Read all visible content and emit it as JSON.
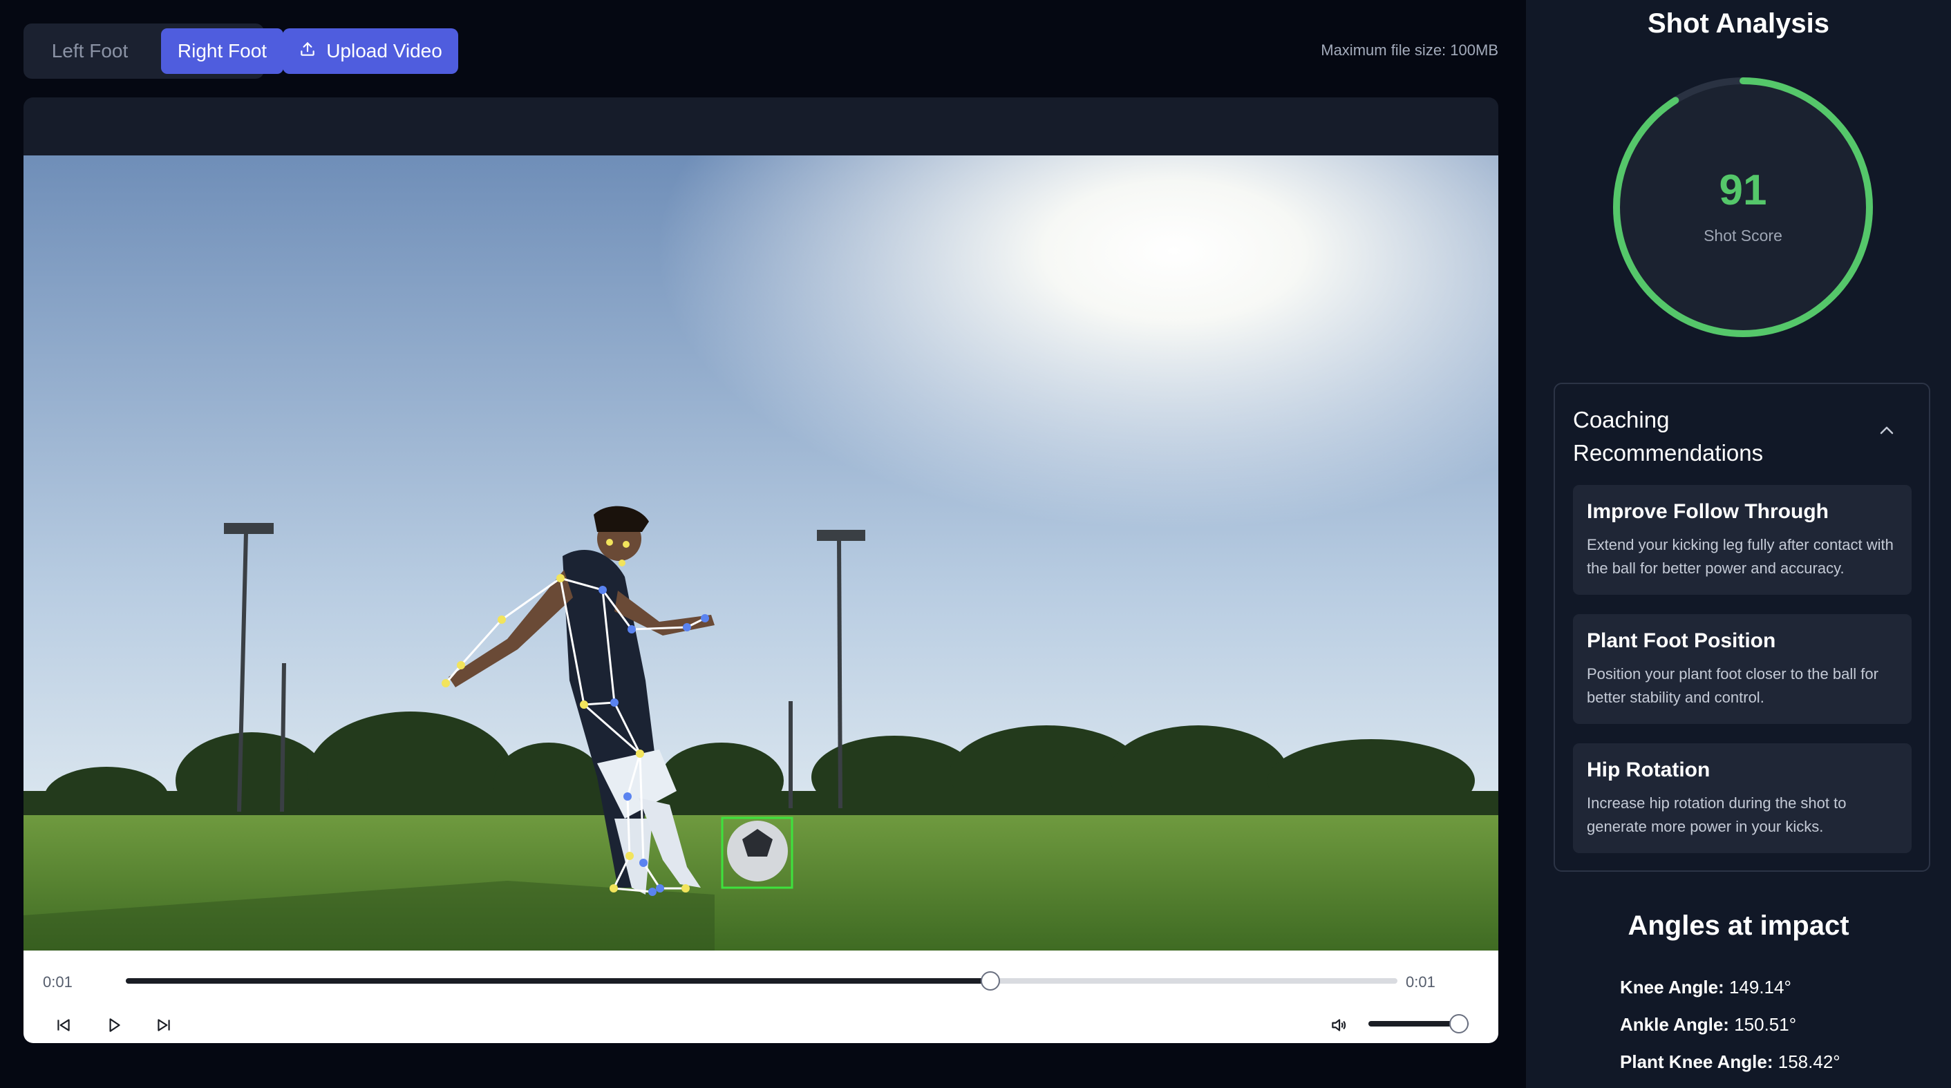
{
  "toolbar": {
    "left_foot_label": "Left Foot",
    "right_foot_label": "Right Foot",
    "selected_foot": "Right Foot",
    "upload_label": "Upload Video",
    "upload_icon": "upload-icon",
    "max_file_size": "Maximum file size: 100MB"
  },
  "player": {
    "current_time": "0:01",
    "duration": "0:01",
    "progress_fraction": 0.68,
    "volume_fraction": 0.9,
    "icons": [
      "skip-back-icon",
      "play-icon",
      "skip-forward-icon",
      "volume-icon"
    ]
  },
  "analysis": {
    "title": "Shot Analysis",
    "score": "91",
    "score_label": "Shot Score",
    "score_fraction": 0.91,
    "score_color": "#55c76a",
    "coaching": {
      "title": "Coaching Recommendations",
      "items": [
        {
          "title": "Improve Follow Through",
          "text": "Extend your kicking leg fully after contact with the ball for better power and accuracy."
        },
        {
          "title": "Plant Foot Position",
          "text": "Position your plant foot closer to the ball for better stability and control."
        },
        {
          "title": "Hip Rotation",
          "text": "Increase hip rotation during the shot to generate more power in your kicks."
        }
      ]
    },
    "angles_title": "Angles at impact",
    "angles": [
      {
        "label": "Knee Angle:",
        "value": "149.14°"
      },
      {
        "label": "Ankle Angle:",
        "value": "150.51°"
      },
      {
        "label": "Plant Knee Angle:",
        "value": "158.42°"
      }
    ]
  },
  "colors": {
    "accent": "#4f5dde",
    "panel_bg": "#111827",
    "page_bg": "#050812"
  }
}
